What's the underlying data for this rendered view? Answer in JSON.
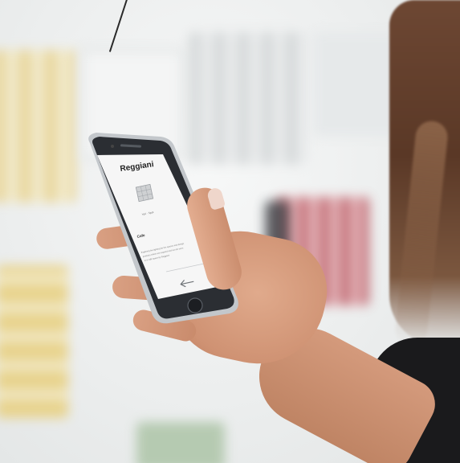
{
  "phone": {
    "brand": "Reggiani",
    "product_caption": "Yori · Spot",
    "section_title": "Cafe",
    "description_lines": [
      "Exploring the lighting for the spaces and design",
      "products which are inspired and can be seen",
      "in a café space by Reggiani"
    ]
  },
  "colors": {
    "phone_body": "#2b2e33",
    "phone_frame": "#b9bdc2",
    "screen": "#f6f6f6",
    "accent_skin": "#d49a7c",
    "hair": "#6d4733"
  },
  "icons": {
    "back": "back-arrow-icon",
    "home": "home-button-icon",
    "product": "product-thumbnail-icon"
  }
}
